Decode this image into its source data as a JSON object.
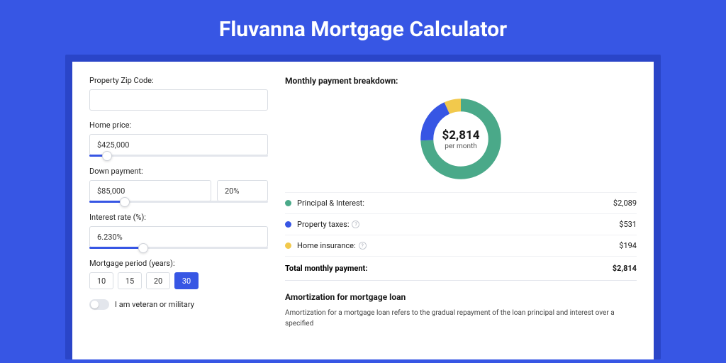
{
  "title": "Fluvanna Mortgage Calculator",
  "colors": {
    "principal": "#4aa989",
    "taxes": "#3756e4",
    "insurance": "#f2c94c"
  },
  "form": {
    "zip": {
      "label": "Property Zip Code:",
      "value": ""
    },
    "price": {
      "label": "Home price:",
      "value": "$425,000",
      "slider_pct": 10
    },
    "down": {
      "label": "Down payment:",
      "value": "$85,000",
      "pct": "20%",
      "slider_pct": 20
    },
    "rate": {
      "label": "Interest rate (%):",
      "value": "6.230%",
      "slider_pct": 30
    },
    "period": {
      "label": "Mortgage period (years):",
      "options": [
        "10",
        "15",
        "20",
        "30"
      ],
      "active": "30"
    },
    "veteran": {
      "label": "I am veteran or military",
      "on": false
    }
  },
  "breakdown": {
    "title": "Monthly payment breakdown:",
    "total_amount": "$2,814",
    "total_sub": "per month",
    "items": [
      {
        "key": "principal",
        "label": "Principal & Interest:",
        "value": "$2,089",
        "info": false
      },
      {
        "key": "taxes",
        "label": "Property taxes:",
        "value": "$531",
        "info": true
      },
      {
        "key": "insurance",
        "label": "Home insurance:",
        "value": "$194",
        "info": true
      }
    ],
    "total_label": "Total monthly payment:",
    "total_value": "$2,814"
  },
  "amort": {
    "title": "Amortization for mortgage loan",
    "text": "Amortization for a mortgage loan refers to the gradual repayment of the loan principal and interest over a specified"
  },
  "chart_data": {
    "type": "pie",
    "title": "Monthly payment breakdown",
    "series": [
      {
        "name": "Principal & Interest",
        "value": 2089
      },
      {
        "name": "Property taxes",
        "value": 531
      },
      {
        "name": "Home insurance",
        "value": 194
      }
    ],
    "total": 2814,
    "unit": "USD per month"
  }
}
